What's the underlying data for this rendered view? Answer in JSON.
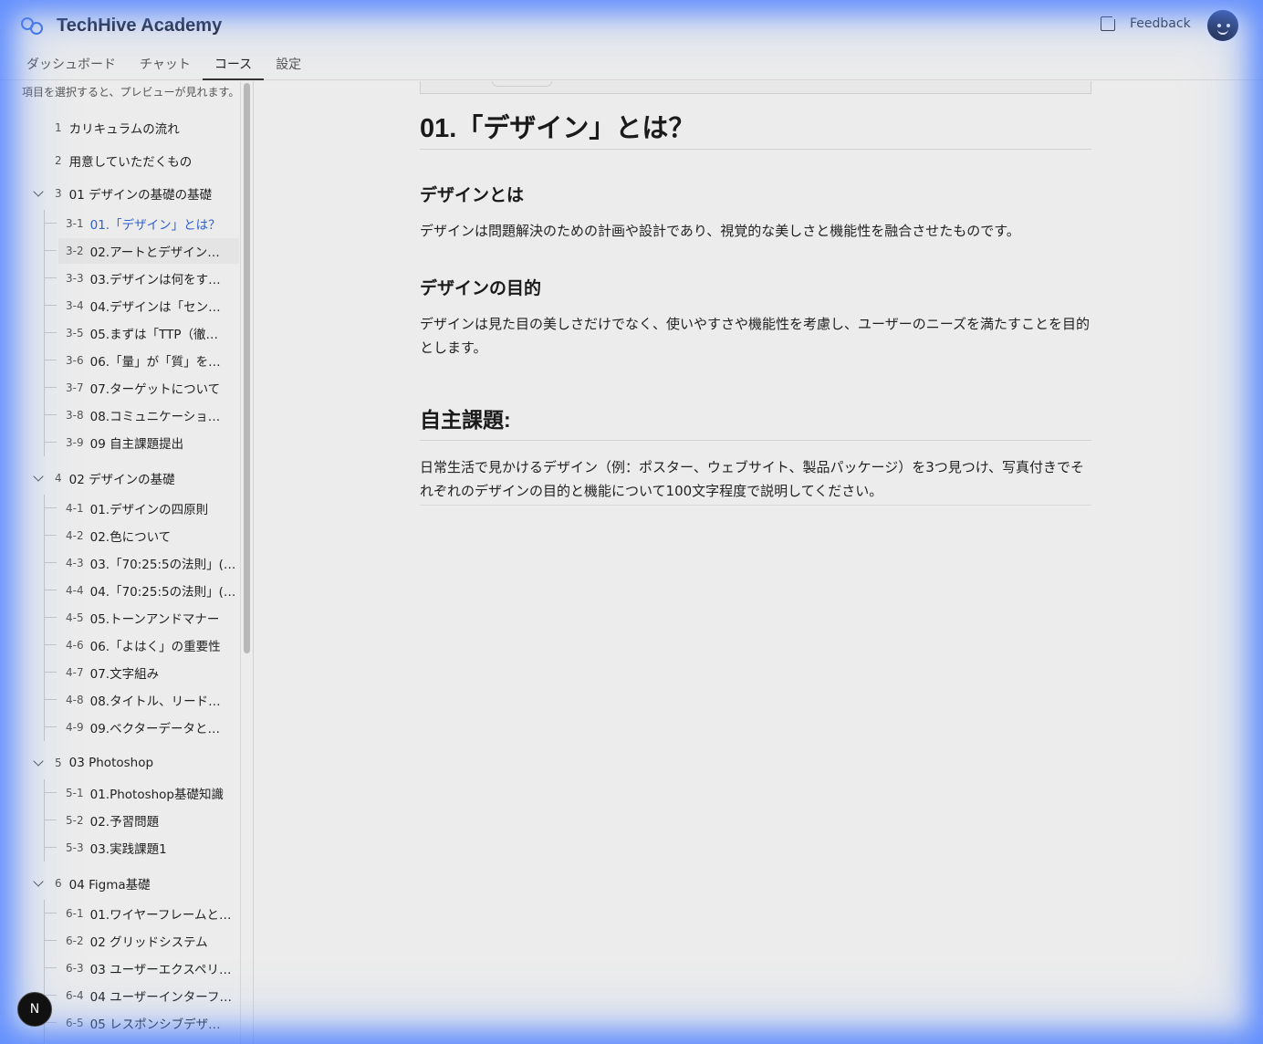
{
  "app": {
    "title": "TechHive Academy",
    "feedback_label": "Feedback",
    "avatar_icon": "avatar-icon",
    "fab_label": "N"
  },
  "tabs": [
    {
      "label": "ダッシュボード",
      "active": false
    },
    {
      "label": "チャット",
      "active": false
    },
    {
      "label": "コース",
      "active": true
    },
    {
      "label": "設定",
      "active": false
    }
  ],
  "sidebar": {
    "hint": "項目を選択すると、プレビューが見れます。",
    "items": [
      {
        "num": "1",
        "label": "カリキュラムの流れ"
      },
      {
        "num": "2",
        "label": "用意していただくもの"
      },
      {
        "num": "3",
        "label": "01 デザインの基礎の基礎",
        "expanded": true,
        "children": [
          {
            "num": "3-1",
            "label": "01.「デザイン」とは？",
            "selected": true
          },
          {
            "num": "3-2",
            "label": "02.アートとデザイン…"
          },
          {
            "num": "3-3",
            "label": "03.デザインは何をす…"
          },
          {
            "num": "3-4",
            "label": "04.デザインは「セン…"
          },
          {
            "num": "3-5",
            "label": "05.まずは「TTP（徹…"
          },
          {
            "num": "3-6",
            "label": "06.「量」が「質」を…"
          },
          {
            "num": "3-7",
            "label": "07.ターゲットについて"
          },
          {
            "num": "3-8",
            "label": "08.コミュニケーショ…"
          },
          {
            "num": "3-9",
            "label": "09 自主課題提出"
          }
        ]
      },
      {
        "num": "4",
        "label": "02 デザインの基礎",
        "expanded": true,
        "children": [
          {
            "num": "4-1",
            "label": "01.デザインの四原則"
          },
          {
            "num": "4-2",
            "label": "02.色について"
          },
          {
            "num": "4-3",
            "label": "03.「70:25:5の法則」(…"
          },
          {
            "num": "4-4",
            "label": "04.「70:25:5の法則」(…"
          },
          {
            "num": "4-5",
            "label": "05.トーンアンドマナー"
          },
          {
            "num": "4-6",
            "label": "06.「よはく」の重要性"
          },
          {
            "num": "4-7",
            "label": "07.文字組み"
          },
          {
            "num": "4-8",
            "label": "08.タイトル、リード…"
          },
          {
            "num": "4-9",
            "label": "09.ベクターデータと…"
          }
        ]
      },
      {
        "num": "5",
        "label": "03 Photoshop",
        "expanded": true,
        "children": [
          {
            "num": "5-1",
            "label": "01.Photoshop基礎知識"
          },
          {
            "num": "5-2",
            "label": "02.予習問題"
          },
          {
            "num": "5-3",
            "label": "03.実践課題1"
          }
        ]
      },
      {
        "num": "6",
        "label": "04 Figma基礎",
        "expanded": true,
        "children": [
          {
            "num": "6-1",
            "label": "01.ワイヤーフレームと…"
          },
          {
            "num": "6-2",
            "label": "02 グリッドシステム"
          },
          {
            "num": "6-3",
            "label": "03 ユーザーエクスペリ…"
          },
          {
            "num": "6-4",
            "label": "04 ユーザーインターフ…"
          },
          {
            "num": "6-5",
            "label": "05 レスポンシブデザ…"
          }
        ]
      }
    ]
  },
  "content": {
    "title": "01.「デザイン」とは？",
    "sections": [
      {
        "heading": "デザインとは",
        "body": "デザインは問題解決のための計画や設計であり、視覚的な美しさと機能性を融合させたものです。"
      },
      {
        "heading": "デザインの目的",
        "body": "デザインは見た目の美しさだけでなく、使いやすさや機能性を考慮し、ユーザーのニーズを満たすことを目的とします。"
      }
    ],
    "assignment_heading": "自主課題:",
    "assignment_body": "日常生活で見かけるデザイン（例：ポスター、ウェブサイト、製品パッケージ）を3つ見つけ、写真付きでそれぞれのデザインの目的と機能について100文字程度で説明してください。"
  }
}
